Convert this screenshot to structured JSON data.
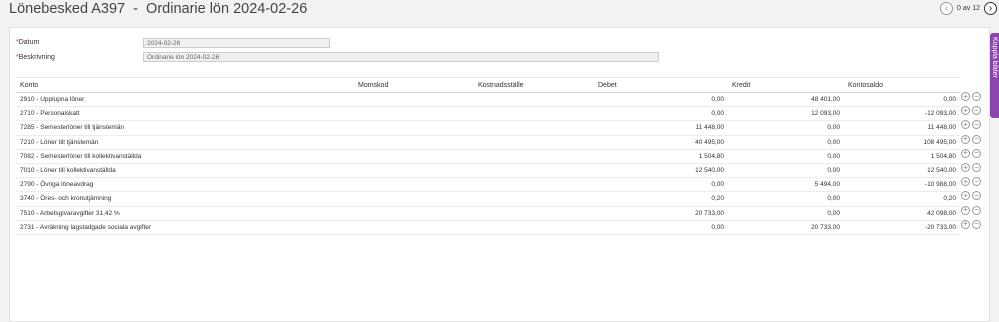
{
  "header": {
    "title": "Lönebesked A397  -  Ordinarie lön 2024-02-26",
    "pager": {
      "prev_icon": "‹",
      "text": "0 av 12",
      "next_icon": "›"
    }
  },
  "side_tab": {
    "label": "Koppla bilder"
  },
  "form": {
    "datum_label": "Datum",
    "datum_value": "2024-02-26",
    "beskrivning_label": "Beskrivning",
    "beskrivning_value": "Ordinarie lön 2024-02-26",
    "required_mark": "*"
  },
  "table": {
    "columns": {
      "konto": "Konto",
      "momskod": "Momskod",
      "kostnadsstalle": "Kostnadsställe",
      "debet": "Debet",
      "kredit": "Kredit",
      "kontosaldo": "Kontosaldo"
    },
    "row_actions": {
      "add_icon": "+",
      "remove_icon": "−"
    },
    "rows": [
      {
        "konto": "2910 - Upplupna löner",
        "momskod": "",
        "kostnadsstalle": "",
        "debet": "0,00",
        "kredit": "48 401,00",
        "kontosaldo": "0,00"
      },
      {
        "konto": "2710 - Personalskatt",
        "momskod": "",
        "kostnadsstalle": "",
        "debet": "0,00",
        "kredit": "12 093,00",
        "kontosaldo": "-12 093,00"
      },
      {
        "konto": "7285 - Semesterlöner till tjänstemän",
        "momskod": "",
        "kostnadsstalle": "",
        "debet": "11 448,00",
        "kredit": "0,00",
        "kontosaldo": "11 448,00"
      },
      {
        "konto": "7210 - Löner till tjänstemän",
        "momskod": "",
        "kostnadsstalle": "",
        "debet": "40 495,00",
        "kredit": "0,00",
        "kontosaldo": "108 495,00"
      },
      {
        "konto": "7082 - Semesterlöner till kollektivanställda",
        "momskod": "",
        "kostnadsstalle": "",
        "debet": "1 504,80",
        "kredit": "0,00",
        "kontosaldo": "1 504,80"
      },
      {
        "konto": "7010 - Löner till kollektivanställda",
        "momskod": "",
        "kostnadsstalle": "",
        "debet": "12 540,00",
        "kredit": "0,00",
        "kontosaldo": "12 540,00"
      },
      {
        "konto": "2790 - Övriga löneavdrag",
        "momskod": "",
        "kostnadsstalle": "",
        "debet": "0,00",
        "kredit": "5 494,00",
        "kontosaldo": "-10 988,00"
      },
      {
        "konto": "3740 - Öres- och kronutjämning",
        "momskod": "",
        "kostnadsstalle": "",
        "debet": "0,20",
        "kredit": "0,00",
        "kontosaldo": "0,20"
      },
      {
        "konto": "7510 - Arbetsgivaravgifter 31,42 %",
        "momskod": "",
        "kostnadsstalle": "",
        "debet": "20 733,00",
        "kredit": "0,00",
        "kontosaldo": "42 098,00"
      },
      {
        "konto": "2731 - Avräkning lagstadgade sociala avgifter",
        "momskod": "",
        "kostnadsstalle": "",
        "debet": "0,00",
        "kredit": "20 733,00",
        "kontosaldo": "-20 733,00"
      }
    ]
  }
}
